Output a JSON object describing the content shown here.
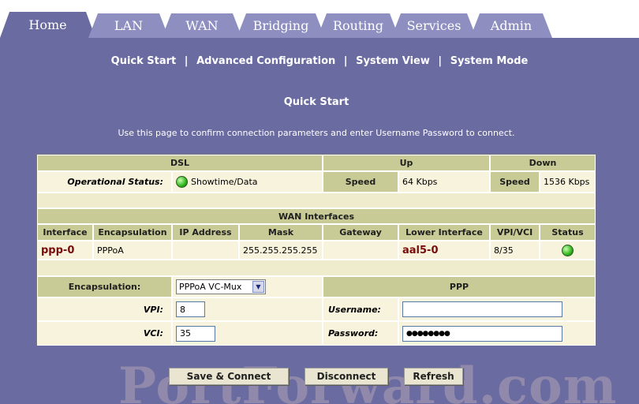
{
  "tabs": [
    {
      "label": "Home"
    },
    {
      "label": "LAN"
    },
    {
      "label": "WAN"
    },
    {
      "label": "Bridging"
    },
    {
      "label": "Routing"
    },
    {
      "label": "Services"
    },
    {
      "label": "Admin"
    }
  ],
  "subnav": [
    "Quick Start",
    "Advanced Configuration",
    "System View",
    "System Mode"
  ],
  "subnav_sep": "|",
  "page": {
    "title": "Quick Start",
    "description": "Use this page to confirm connection parameters and enter Username Password to connect."
  },
  "dsl": {
    "header": "DSL",
    "up_header": "Up",
    "down_header": "Down",
    "op_status_label": "Operational Status:",
    "op_status_value": "Showtime/Data",
    "speed_label": "Speed",
    "up_speed": "64 Kbps",
    "down_speed": "1536 Kbps"
  },
  "wan": {
    "header": "WAN Interfaces",
    "columns": [
      "Interface",
      "Encapsulation",
      "IP Address",
      "Mask",
      "Gateway",
      "Lower Interface",
      "VPI/VCI",
      "Status"
    ],
    "row": {
      "interface": "ppp-0",
      "encapsulation": "PPPoA",
      "ip_address": "",
      "mask": "255.255.255.255",
      "gateway": "",
      "lower_interface": "aal5-0",
      "vpi_vci": "8/35"
    }
  },
  "form": {
    "encapsulation_label": "Encapsulation:",
    "encapsulation_value": "PPPoA VC-Mux",
    "ppp_header": "PPP",
    "vpi_label": "VPI:",
    "vpi_value": "8",
    "vci_label": "VCI:",
    "vci_value": "35",
    "username_label": "Username:",
    "username_value": "",
    "password_label": "Password:",
    "password_value": "●●●●●●●●"
  },
  "buttons": {
    "save": "Save & Connect",
    "disconnect": "Disconnect",
    "refresh": "Refresh"
  },
  "watermark": "PortForward.com",
  "colors": {
    "background": "#6a6ba0",
    "tab": "#8e8fc0",
    "header_cell": "#c9cb96",
    "panel": "#f6f1d8",
    "status_led": "#2fb41a"
  }
}
